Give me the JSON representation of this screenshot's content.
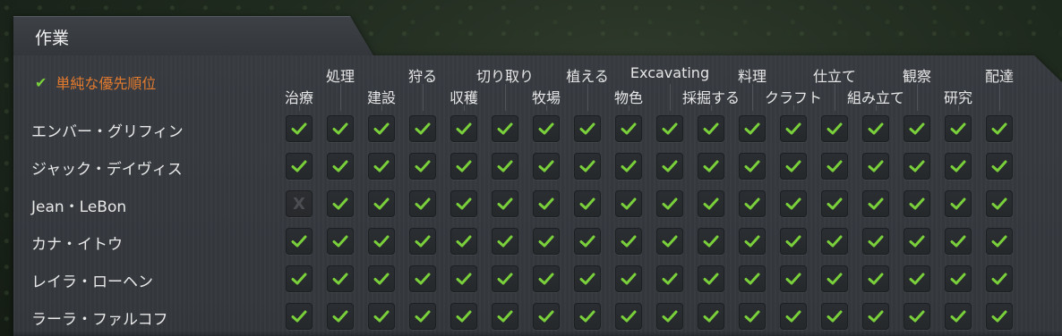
{
  "window": {
    "title": "作業"
  },
  "priority_toggle": {
    "label": "単純な優先順位",
    "checked": true
  },
  "columns": [
    {
      "label": "治療"
    },
    {
      "label": "処理"
    },
    {
      "label": "建設"
    },
    {
      "label": "狩る"
    },
    {
      "label": "収穫"
    },
    {
      "label": "切り取り"
    },
    {
      "label": "牧場"
    },
    {
      "label": "植える"
    },
    {
      "label": "物色"
    },
    {
      "label": "Excavating"
    },
    {
      "label": "採掘する"
    },
    {
      "label": "料理"
    },
    {
      "label": "クラフト"
    },
    {
      "label": "仕立て"
    },
    {
      "label": "組み立て"
    },
    {
      "label": "観察"
    },
    {
      "label": "研究"
    },
    {
      "label": "配達"
    }
  ],
  "colonists": [
    {
      "name": "エンバー・グリフィン",
      "work": [
        true,
        true,
        true,
        true,
        true,
        true,
        true,
        true,
        true,
        true,
        true,
        true,
        true,
        true,
        true,
        true,
        true,
        true
      ]
    },
    {
      "name": "ジャック・デイヴィス",
      "work": [
        true,
        true,
        true,
        true,
        true,
        true,
        true,
        true,
        true,
        true,
        true,
        true,
        true,
        true,
        true,
        true,
        true,
        true
      ]
    },
    {
      "name": "Jean・LeBon",
      "work": [
        false,
        true,
        true,
        true,
        true,
        true,
        true,
        true,
        true,
        true,
        true,
        true,
        true,
        true,
        true,
        true,
        true,
        true
      ]
    },
    {
      "name": "カナ・イトウ",
      "work": [
        true,
        true,
        true,
        true,
        true,
        true,
        true,
        true,
        true,
        true,
        true,
        true,
        true,
        true,
        true,
        true,
        true,
        true
      ]
    },
    {
      "name": "レイラ・ローヘン",
      "work": [
        true,
        true,
        true,
        true,
        true,
        true,
        true,
        true,
        true,
        true,
        true,
        true,
        true,
        true,
        true,
        true,
        true,
        true
      ]
    },
    {
      "name": "ラーラ・ファルコフ",
      "work": [
        true,
        true,
        true,
        true,
        true,
        true,
        true,
        true,
        true,
        true,
        true,
        true,
        true,
        true,
        true,
        true,
        true,
        true
      ]
    }
  ],
  "colors": {
    "accent_orange": "#e27a2e",
    "check_green": "#7ad03b",
    "disabled_mark": "#4a4d51"
  },
  "icons": {
    "enabled": "check-icon",
    "disabled": "x-icon"
  },
  "disabled_symbol": "X"
}
